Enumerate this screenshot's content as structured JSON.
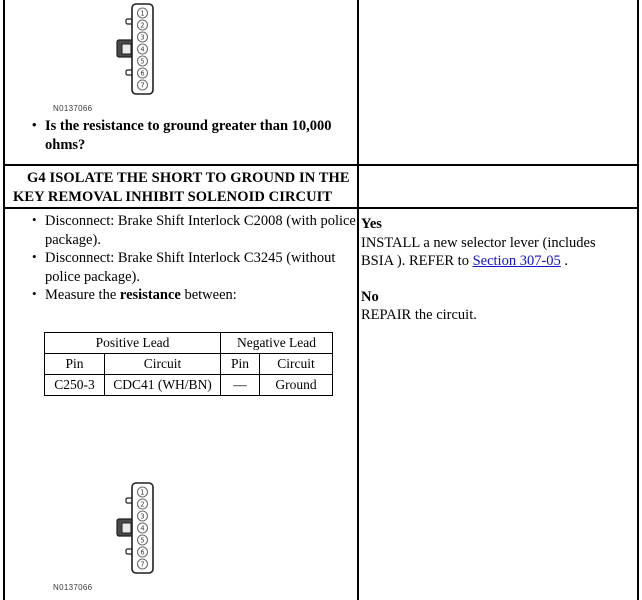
{
  "document": {
    "type": "diagnostic-pinpoint-test-table"
  },
  "question_row": {
    "connector": {
      "ref_label": "N0137066",
      "pins": [
        "1",
        "2",
        "3",
        "4",
        "5",
        "6",
        "7"
      ]
    },
    "bullets": [
      "Is the resistance to ground greater than 10,000 ohms?"
    ],
    "answer_cell": ""
  },
  "step_header": {
    "line1": "G4 ISOLATE THE SHORT TO GROUND IN THE",
    "line2": "KEY REMOVAL INHIBIT SOLENOID CIRCUIT",
    "right_cell": ""
  },
  "step_body": {
    "bullets": [
      {
        "pre": "Disconnect: Brake Shift Interlock C2008 (with police package).",
        "bold": "",
        "post": ""
      },
      {
        "pre": "Disconnect: Brake Shift Interlock C3245 (without police package).",
        "bold": "",
        "post": ""
      },
      {
        "pre": "Measure the ",
        "bold": "resistance",
        "post": " between:"
      }
    ],
    "table": {
      "group_headers": [
        "Positive Lead",
        "Negative Lead"
      ],
      "column_headers": [
        "Pin",
        "Circuit",
        "Pin",
        "Circuit"
      ],
      "rows": [
        [
          "C250-3",
          "CDC41 (WH/BN)",
          "—",
          "Ground"
        ]
      ]
    },
    "connector": {
      "ref_label": "N0137066",
      "pins": [
        "1",
        "2",
        "3",
        "4",
        "5",
        "6",
        "7"
      ]
    }
  },
  "results": {
    "yes_label": "Yes",
    "yes_text_before": "INSTALL a new selector lever (includes BSIA ). REFER to ",
    "yes_link": "Section 307-05",
    "yes_text_after": " .",
    "no_label": "No",
    "no_text": "REPAIR the circuit."
  },
  "colors": {
    "link": "#1414c8",
    "rule": "#000000",
    "connector_outline": "#231f20",
    "connector_label": "#3a3a3a"
  }
}
